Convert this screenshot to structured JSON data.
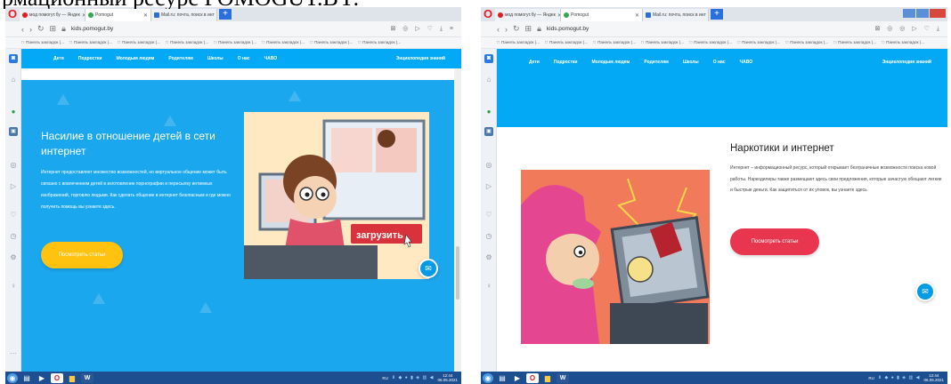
{
  "doc_title": "рмационный ресурс POMOGUT.BY:",
  "browser": {
    "url": "kids.pomogut.by",
    "left_tabs": [
      "мод помогут.бу — Яндек",
      "Pomogut",
      "Mail.ru: почта, поиск в инт"
    ],
    "right_tabs": [
      "мод помогут.бу — Яндек",
      "Pomogut",
      "Mail.ru: почта, поиск в инт"
    ],
    "bookmark_label": "Панель закладок (...",
    "bookmark_count_left": 8,
    "bookmark_count_right": 9
  },
  "site_nav": {
    "items": [
      "Дети",
      "Подростки",
      "Молодым людям",
      "Родителям",
      "Школы",
      "О нас",
      "ЧАВО"
    ],
    "encyclopedia": "Энциклопедия знаний"
  },
  "left_panel": {
    "heading": "Насилие в отношение детей в сети интернет",
    "text": "Интернет предоставляет множество возможностей, но виртуальное общение может быть связано с вовлечением детей в изготовление порнографии и пересылку интимных изображений, торговлю людьми. Как сделать общение в интернет безопасным и где можно получить помощь вы узнаете здесь.",
    "button": "Посмотреть статьи",
    "illustration_label": "загрузить",
    "hero_color": "#1aa7ee",
    "button_color": "#ffc20e"
  },
  "right_panel": {
    "heading": "Наркотики и интернет",
    "text": "Интернет – информационный ресурс, который открывает безграничные возможности поиска новой работы. Наркодилеры также размещают здесь свои предложения, которые зачастую обещают легкие и быстрые деньги. Как защититься от их уловок, вы узнаете здесь",
    "button": "Посмотреть статьи",
    "button_color": "#e8364f"
  },
  "taskbar": {
    "lang": "RU",
    "time": "12:44",
    "date": "06.05.2021"
  },
  "icons": [
    "opera-logo",
    "back-arrow",
    "forward-arrow",
    "reload",
    "home",
    "lock",
    "bookmark",
    "download",
    "menu",
    "chat",
    "start",
    "explorer",
    "word"
  ]
}
